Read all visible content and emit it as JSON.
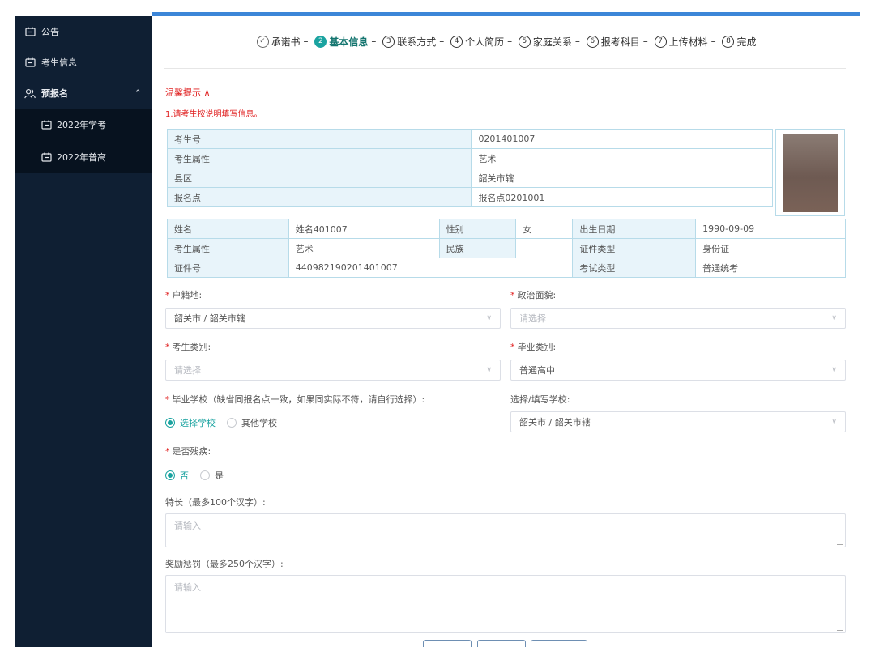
{
  "sidebar": {
    "items": [
      {
        "label": "公告",
        "icon": "notice-icon"
      },
      {
        "label": "考生信息",
        "icon": "notice-icon"
      },
      {
        "label": "预报名",
        "icon": "users-icon"
      }
    ],
    "subitems": [
      {
        "label": "2022年学考"
      },
      {
        "label": "2022年普高"
      }
    ]
  },
  "steps": [
    {
      "num": "✓",
      "label": "承诺书",
      "state": "done"
    },
    {
      "num": "2",
      "label": "基本信息",
      "state": "active"
    },
    {
      "num": "3",
      "label": "联系方式",
      "state": "todo"
    },
    {
      "num": "4",
      "label": "个人简历",
      "state": "todo"
    },
    {
      "num": "5",
      "label": "家庭关系",
      "state": "todo"
    },
    {
      "num": "6",
      "label": "报考科目",
      "state": "todo"
    },
    {
      "num": "7",
      "label": "上传材料",
      "state": "todo"
    },
    {
      "num": "8",
      "label": "完成",
      "state": "todo"
    }
  ],
  "tips": {
    "title": "温馨提示 ∧",
    "text": "1.请考生按说明填写信息。"
  },
  "info1": {
    "rows": [
      {
        "label": "考生号",
        "value": "0201401007"
      },
      {
        "label": "考生属性",
        "value": "艺术"
      },
      {
        "label": "县区",
        "value": "韶关市辖"
      },
      {
        "label": "报名点",
        "value": "报名点0201001"
      }
    ]
  },
  "info2": {
    "name_label": "姓名",
    "name_value": "姓名401007",
    "gender_label": "性别",
    "gender_value": "女",
    "birth_label": "出生日期",
    "birth_value": "1990-09-09",
    "attr_label": "考生属性",
    "attr_value": "艺术",
    "ethnic_label": "民族",
    "ethnic_value": "",
    "idtype_label": "证件类型",
    "idtype_value": "身份证",
    "idno_label": "证件号",
    "idno_value": "440982190201401007",
    "examtype_label": "考试类型",
    "examtype_value": "普通统考"
  },
  "form": {
    "huji_label": "户籍地:",
    "huji_value": "韶关市 / 韶关市辖",
    "zzmm_label": "政治面貌:",
    "zzmm_placeholder": "请选择",
    "kslb_label": "考生类别:",
    "kslb_placeholder": "请选择",
    "bylb_label": "毕业类别:",
    "bylb_value": "普通高中",
    "byxx_label": "毕业学校（缺省同报名点一致，如果同实际不符，请自行选择）:",
    "byxx_options": [
      "选择学校",
      "其他学校"
    ],
    "xztx_label": "选择/填写学校:",
    "xztx_value": "韶关市 / 韶关市辖",
    "sfcj_label": "是否残疾:",
    "sfcj_options": [
      "否",
      "是"
    ],
    "tc_label": "特长（最多100个汉字）:",
    "tc_placeholder": "请输入",
    "jl_label": "奖励惩罚（最多250个汉字）:",
    "jl_placeholder": "请输入"
  },
  "colors": {
    "accent": "#1aa3a0",
    "sidebar": "#0f1f33",
    "topbar": "#3c86d8",
    "required": "#e02020"
  }
}
